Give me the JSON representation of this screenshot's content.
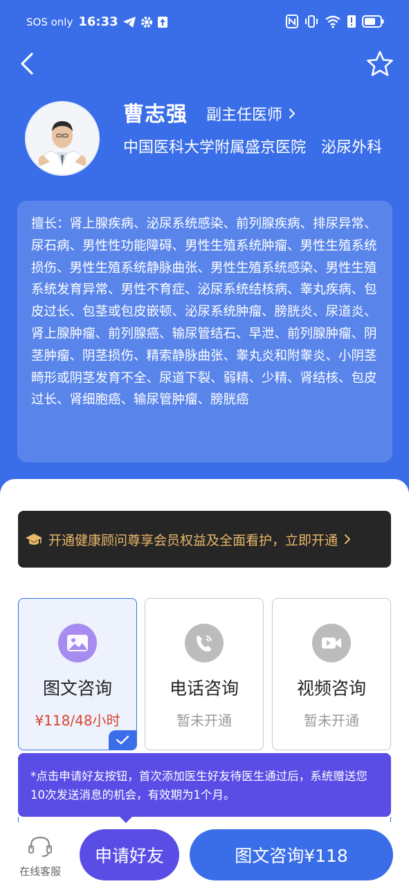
{
  "status_bar": {
    "carrier": "SOS only",
    "time": "16:33",
    "colors": {
      "foreground": "#ffffff"
    }
  },
  "nav": {
    "back_icon": "chevron-left-icon",
    "favorite_icon": "star-outline-icon"
  },
  "doctor": {
    "name": "曹志强",
    "title": "副主任医师",
    "hospital_department": "中国医科大学附属盛京医院　泌尿外科",
    "specialty": "擅长：肾上腺疾病、泌尿系统感染、前列腺疾病、排尿异常、尿石病、男性性功能障碍、男性生殖系统肿瘤、男性生殖系统损伤、男性生殖系统静脉曲张、男性生殖系统感染、男性生殖系统发育异常、男性不育症、泌尿系统结核病、睾丸疾病、包皮过长、包茎或包皮嵌顿、泌尿系统肿瘤、膀胱炎、尿道炎、肾上腺肿瘤、前列腺癌、输尿管结石、早泄、前列腺肿瘤、阴茎肿瘤、阴茎损伤、精索静脉曲张、睾丸炎和附睾炎、小阴茎畸形或阴茎发育不全、尿道下裂、弱精、少精、肾结核、包皮过长、肾细胞癌、输尿管肿瘤、膀胱癌"
  },
  "vip_banner": {
    "text": "开通健康顾问尊享会员权益及全面看护，立即开通",
    "icon": "graduation-cap-icon"
  },
  "consult_options": [
    {
      "label": "图文咨询",
      "price": "¥118/48小时",
      "icon": "image-icon",
      "selected": true
    },
    {
      "label": "电话咨询",
      "status": "暂未开通",
      "icon": "phone-icon",
      "selected": false
    },
    {
      "label": "视频咨询",
      "status": "暂未开通",
      "icon": "video-icon",
      "selected": false
    }
  ],
  "tooltip": {
    "text": "*点击申请好友按钮，首次添加医生好友待医生通过后，系统赠送您10次发送消息的机会，有效期为1个月。"
  },
  "bottom_bar": {
    "service_label": "在线客服",
    "friend_button": "申请好友",
    "consult_button": "图文咨询¥118"
  },
  "colors": {
    "header_blue": "#3a6ee8",
    "accent_purple": "#5a4de6",
    "price_red": "#d9432f",
    "vip_gold": "#e9b86a",
    "vip_bg": "#262626"
  }
}
